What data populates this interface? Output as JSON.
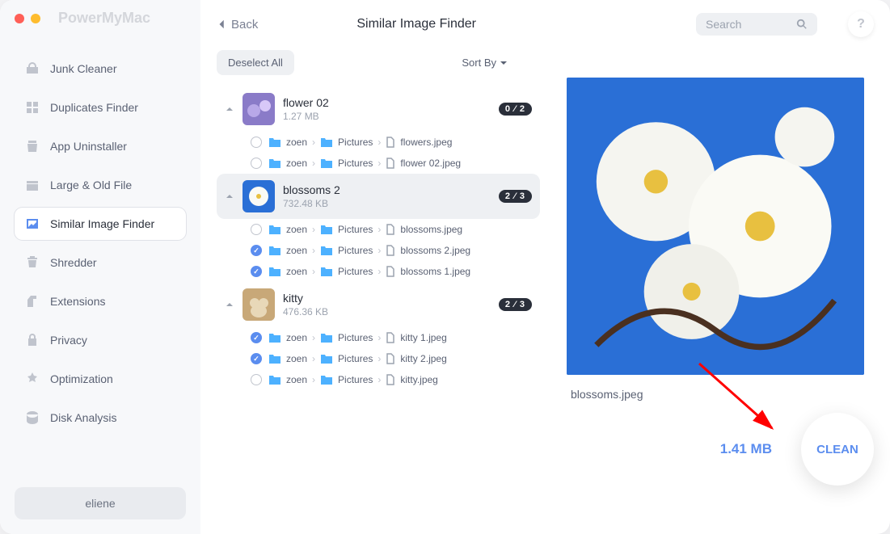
{
  "brand": "PowerMyMac",
  "back_label": "Back",
  "page_title": "Similar Image Finder",
  "search_placeholder": "Search",
  "help_label": "?",
  "sidebar": {
    "items": [
      {
        "label": "Junk Cleaner"
      },
      {
        "label": "Duplicates Finder"
      },
      {
        "label": "App Uninstaller"
      },
      {
        "label": "Large & Old File"
      },
      {
        "label": "Similar Image Finder"
      },
      {
        "label": "Shredder"
      },
      {
        "label": "Extensions"
      },
      {
        "label": "Privacy"
      },
      {
        "label": "Optimization"
      },
      {
        "label": "Disk Analysis"
      }
    ],
    "user": "eliene"
  },
  "controls": {
    "deselect_label": "Deselect All",
    "sortby_label": "Sort By"
  },
  "path_common": {
    "user": "zoen",
    "folder": "Pictures"
  },
  "groups": [
    {
      "name": "flower 02",
      "size": "1.27 MB",
      "badge": "0 ⁄ 2",
      "files": [
        {
          "name": "flowers.jpeg",
          "checked": false
        },
        {
          "name": "flower 02.jpeg",
          "checked": false
        }
      ]
    },
    {
      "name": "blossoms 2",
      "size": "732.48 KB",
      "badge": "2 ⁄ 3",
      "files": [
        {
          "name": "blossoms.jpeg",
          "checked": false
        },
        {
          "name": "blossoms 2.jpeg",
          "checked": true
        },
        {
          "name": "blossoms 1.jpeg",
          "checked": true
        }
      ]
    },
    {
      "name": "kitty",
      "size": "476.36 KB",
      "badge": "2 ⁄ 3",
      "files": [
        {
          "name": "kitty 1.jpeg",
          "checked": true
        },
        {
          "name": "kitty 2.jpeg",
          "checked": true
        },
        {
          "name": "kitty.jpeg",
          "checked": false
        }
      ]
    }
  ],
  "preview": {
    "filename": "blossoms.jpeg"
  },
  "footer": {
    "total_size": "1.41 MB",
    "clean_label": "CLEAN"
  }
}
